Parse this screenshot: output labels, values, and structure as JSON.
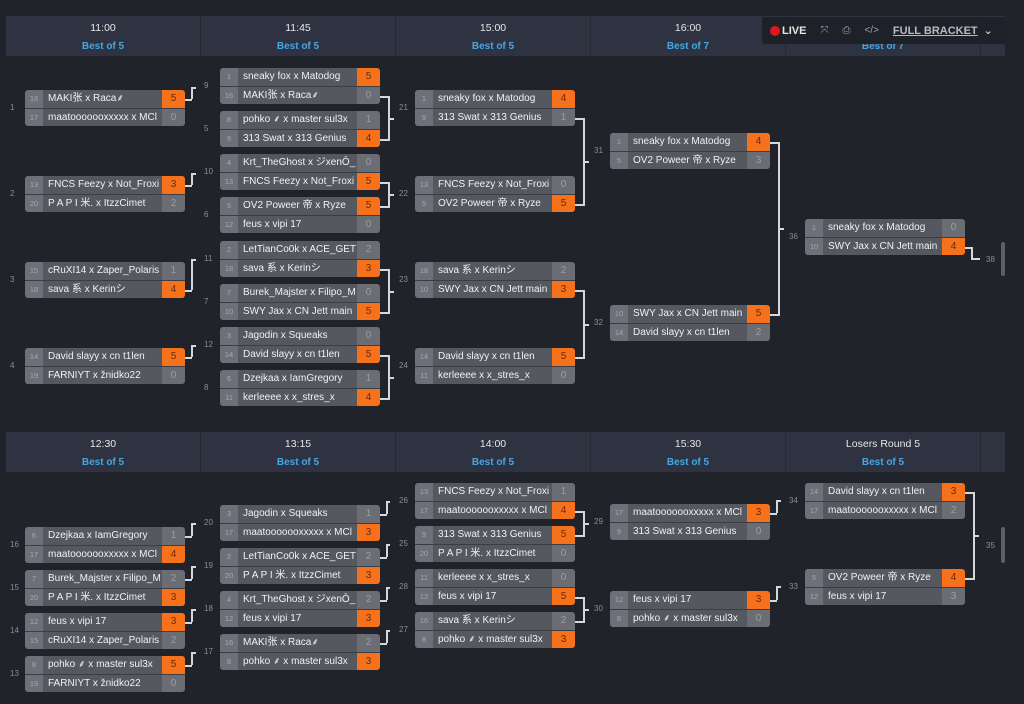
{
  "toolbar": {
    "live_label": "LIVE",
    "expand_icon": "expand-icon",
    "print_icon": "print-icon",
    "embed_icon": "code-icon",
    "full_bracket_label": "FULL BRACKET",
    "chevron": "chevron-down-icon"
  },
  "colors": {
    "accent_orange": "#f5711c",
    "link_blue": "#45a7e6",
    "live_red": "#e5161b",
    "background": "#21232b"
  },
  "upper_headers": [
    {
      "time": "11:00",
      "format": "Best of 5"
    },
    {
      "time": "11:45",
      "format": "Best of 5"
    },
    {
      "time": "15:00",
      "format": "Best of 5"
    },
    {
      "time": "16:00",
      "format": "Best of 7"
    },
    {
      "time": "",
      "format": "Best of 7"
    }
  ],
  "lower_headers": [
    {
      "time": "12:30",
      "format": "Best of 5"
    },
    {
      "time": "13:15",
      "format": "Best of 5"
    },
    {
      "time": "14:00",
      "format": "Best of 5"
    },
    {
      "time": "15:30",
      "format": "Best of 5"
    },
    {
      "time": "Losers Round 5",
      "format": "Best of 5"
    }
  ],
  "matches": [
    {
      "id": "1",
      "teams": [
        {
          "seed": "16",
          "name": "MAKI张 x Raca⸙",
          "score": "5",
          "win": true
        },
        {
          "seed": "17",
          "name": "maatooooooxxxxx x MCl",
          "score": "0",
          "win": false
        }
      ]
    },
    {
      "id": "2",
      "teams": [
        {
          "seed": "13",
          "name": "FNCS Feezy x Not_Froxi",
          "score": "3",
          "win": true
        },
        {
          "seed": "20",
          "name": "P A P I 米. x ItzzCimet",
          "score": "2",
          "win": false
        }
      ]
    },
    {
      "id": "3",
      "teams": [
        {
          "seed": "15",
          "name": "cRuXI14 x Zaper_Polaris",
          "score": "1",
          "win": false
        },
        {
          "seed": "18",
          "name": "sava 系 x Kerinシ",
          "score": "4",
          "win": true
        }
      ]
    },
    {
      "id": "4",
      "teams": [
        {
          "seed": "14",
          "name": "David slayy x cn t1len",
          "score": "5",
          "win": true
        },
        {
          "seed": "19",
          "name": "FARNIYT x žnidko22",
          "score": "0",
          "win": false
        }
      ]
    },
    {
      "id": "9",
      "teams": [
        {
          "seed": "1",
          "name": "sneaky fox x Matodog",
          "score": "5",
          "win": true
        },
        {
          "seed": "16",
          "name": "MAKI张 x Raca⸙",
          "score": "0",
          "win": false
        }
      ]
    },
    {
      "id": "5",
      "teams": [
        {
          "seed": "8",
          "name": "pohko ⸙ x master sul3x",
          "score": "1",
          "win": false
        },
        {
          "seed": "9",
          "name": "313 Swat x 313 Genius",
          "score": "4",
          "win": true
        }
      ]
    },
    {
      "id": "10",
      "teams": [
        {
          "seed": "4",
          "name": "Krt_TheGhost x ジxenŌ_",
          "score": "0",
          "win": false
        },
        {
          "seed": "13",
          "name": "FNCS Feezy x Not_Froxi",
          "score": "5",
          "win": true
        }
      ]
    },
    {
      "id": "6",
      "teams": [
        {
          "seed": "5",
          "name": "OV2 Poweer 帝 x Ryze",
          "score": "5",
          "win": true
        },
        {
          "seed": "12",
          "name": "feus x vipi 17",
          "score": "0",
          "win": false
        }
      ]
    },
    {
      "id": "11",
      "teams": [
        {
          "seed": "2",
          "name": "LetTianCo0k x ACE_GET",
          "score": "2",
          "win": false
        },
        {
          "seed": "18",
          "name": "sava 系 x Kerinシ",
          "score": "3",
          "win": true
        }
      ]
    },
    {
      "id": "7",
      "teams": [
        {
          "seed": "7",
          "name": "Burek_Majster x Filipo_M",
          "score": "0",
          "win": false
        },
        {
          "seed": "10",
          "name": "SWY Jax x CN Jett main",
          "score": "5",
          "win": true
        }
      ]
    },
    {
      "id": "12",
      "teams": [
        {
          "seed": "3",
          "name": "Jagodin x Squeaks",
          "score": "0",
          "win": false
        },
        {
          "seed": "14",
          "name": "David slayy x cn t1len",
          "score": "5",
          "win": true
        }
      ]
    },
    {
      "id": "8",
      "teams": [
        {
          "seed": "6",
          "name": "Dzejkaa x IamGregory",
          "score": "1",
          "win": false
        },
        {
          "seed": "11",
          "name": "kerleeee x x_stres_x",
          "score": "4",
          "win": true
        }
      ]
    },
    {
      "id": "21",
      "teams": [
        {
          "seed": "1",
          "name": "sneaky fox x Matodog",
          "score": "4",
          "win": true
        },
        {
          "seed": "9",
          "name": "313 Swat x 313 Genius",
          "score": "1",
          "win": false
        }
      ]
    },
    {
      "id": "22",
      "teams": [
        {
          "seed": "13",
          "name": "FNCS Feezy x Not_Froxi",
          "score": "0",
          "win": false
        },
        {
          "seed": "5",
          "name": "OV2 Poweer 帝 x Ryze",
          "score": "5",
          "win": true
        }
      ]
    },
    {
      "id": "23",
      "teams": [
        {
          "seed": "18",
          "name": "sava 系 x Kerinシ",
          "score": "2",
          "win": false
        },
        {
          "seed": "10",
          "name": "SWY Jax x CN Jett main",
          "score": "3",
          "win": true
        }
      ]
    },
    {
      "id": "24",
      "teams": [
        {
          "seed": "14",
          "name": "David slayy x cn t1len",
          "score": "5",
          "win": true
        },
        {
          "seed": "11",
          "name": "kerleeee x x_stres_x",
          "score": "0",
          "win": false
        }
      ]
    },
    {
      "id": "31",
      "teams": [
        {
          "seed": "1",
          "name": "sneaky fox x Matodog",
          "score": "4",
          "win": true
        },
        {
          "seed": "5",
          "name": "OV2 Poweer 帝 x Ryze",
          "score": "3",
          "win": false
        }
      ]
    },
    {
      "id": "32",
      "teams": [
        {
          "seed": "10",
          "name": "SWY Jax x CN Jett main",
          "score": "5",
          "win": true
        },
        {
          "seed": "14",
          "name": "David slayy x cn t1len",
          "score": "2",
          "win": false
        }
      ]
    },
    {
      "id": "36",
      "teams": [
        {
          "seed": "1",
          "name": "sneaky fox x Matodog",
          "score": "0",
          "win": false
        },
        {
          "seed": "10",
          "name": "SWY Jax x CN Jett main",
          "score": "4",
          "win": true
        }
      ]
    },
    {
      "id": "16",
      "teams": [
        {
          "seed": "6",
          "name": "Dzejkaa x IamGregory",
          "score": "1",
          "win": false
        },
        {
          "seed": "17",
          "name": "maatooooooxxxxx x MCl",
          "score": "4",
          "win": true
        }
      ]
    },
    {
      "id": "15",
      "teams": [
        {
          "seed": "7",
          "name": "Burek_Majster x Filipo_M",
          "score": "2",
          "win": false
        },
        {
          "seed": "20",
          "name": "P A P I 米. x ItzzCimet",
          "score": "3",
          "win": true
        }
      ]
    },
    {
      "id": "14",
      "teams": [
        {
          "seed": "12",
          "name": "feus x vipi 17",
          "score": "3",
          "win": true
        },
        {
          "seed": "15",
          "name": "cRuXI14 x Zaper_Polaris",
          "score": "2",
          "win": false
        }
      ]
    },
    {
      "id": "13",
      "teams": [
        {
          "seed": "8",
          "name": "pohko ⸙ x master sul3x",
          "score": "5",
          "win": true
        },
        {
          "seed": "19",
          "name": "FARNIYT x žnidko22",
          "score": "0",
          "win": false
        }
      ]
    },
    {
      "id": "20",
      "teams": [
        {
          "seed": "3",
          "name": "Jagodin x Squeaks",
          "score": "1",
          "win": false
        },
        {
          "seed": "17",
          "name": "maatooooooxxxxx x MCl",
          "score": "3",
          "win": true
        }
      ]
    },
    {
      "id": "19",
      "teams": [
        {
          "seed": "2",
          "name": "LetTianCo0k x ACE_GET",
          "score": "2",
          "win": false
        },
        {
          "seed": "20",
          "name": "P A P I 米. x ItzzCimet",
          "score": "3",
          "win": true
        }
      ]
    },
    {
      "id": "18",
      "teams": [
        {
          "seed": "4",
          "name": "Krt_TheGhost x ジxenŌ_",
          "score": "2",
          "win": false
        },
        {
          "seed": "12",
          "name": "feus x vipi 17",
          "score": "3",
          "win": true
        }
      ]
    },
    {
      "id": "17",
      "teams": [
        {
          "seed": "16",
          "name": "MAKI张 x Raca⸙",
          "score": "2",
          "win": false
        },
        {
          "seed": "8",
          "name": "pohko ⸙ x master sul3x",
          "score": "3",
          "win": true
        }
      ]
    },
    {
      "id": "26",
      "teams": [
        {
          "seed": "13",
          "name": "FNCS Feezy x Not_Froxi",
          "score": "1",
          "win": false
        },
        {
          "seed": "17",
          "name": "maatooooooxxxxx x MCl",
          "score": "4",
          "win": true
        }
      ]
    },
    {
      "id": "25",
      "teams": [
        {
          "seed": "9",
          "name": "313 Swat x 313 Genius",
          "score": "5",
          "win": true
        },
        {
          "seed": "20",
          "name": "P A P I 米. x ItzzCimet",
          "score": "0",
          "win": false
        }
      ]
    },
    {
      "id": "28",
      "teams": [
        {
          "seed": "11",
          "name": "kerleeee x x_stres_x",
          "score": "0",
          "win": false
        },
        {
          "seed": "12",
          "name": "feus x vipi 17",
          "score": "5",
          "win": true
        }
      ]
    },
    {
      "id": "27",
      "teams": [
        {
          "seed": "16",
          "name": "sava 系 x Kerinシ",
          "score": "2",
          "win": false
        },
        {
          "seed": "8",
          "name": "pohko ⸙ x master sul3x",
          "score": "3",
          "win": true
        }
      ]
    },
    {
      "id": "29",
      "teams": [
        {
          "seed": "17",
          "name": "maatooooooxxxxx x MCl",
          "score": "3",
          "win": true
        },
        {
          "seed": "9",
          "name": "313 Swat x 313 Genius",
          "score": "0",
          "win": false
        }
      ]
    },
    {
      "id": "30",
      "teams": [
        {
          "seed": "12",
          "name": "feus x vipi 17",
          "score": "3",
          "win": true
        },
        {
          "seed": "8",
          "name": "pohko ⸙ x master sul3x",
          "score": "0",
          "win": false
        }
      ]
    },
    {
      "id": "34",
      "teams": [
        {
          "seed": "14",
          "name": "David slayy x cn t1len",
          "score": "3",
          "win": true
        },
        {
          "seed": "17",
          "name": "maatooooooxxxxx x MCl",
          "score": "2",
          "win": false
        }
      ]
    },
    {
      "id": "33",
      "teams": [
        {
          "seed": "5",
          "name": "OV2 Poweer 帝 x Ryze",
          "score": "4",
          "win": true
        },
        {
          "seed": "12",
          "name": "feus x vipi 17",
          "score": "3",
          "win": false
        }
      ]
    }
  ],
  "next_labels": {
    "upper_final": "38",
    "lower_final": "35"
  }
}
